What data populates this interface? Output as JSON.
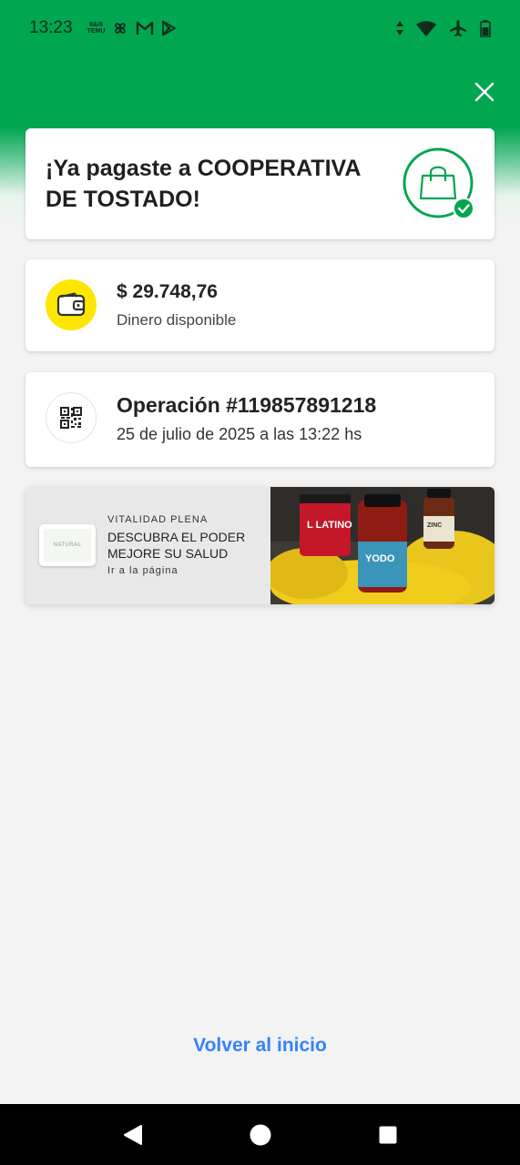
{
  "status_bar": {
    "time": "13:23",
    "left_icons": [
      "temu-icon",
      "pinwheel-icon",
      "gmail-icon",
      "play-store-icon"
    ],
    "right_icons": [
      "data-arrows-icon",
      "wifi-icon",
      "airplane-icon",
      "battery-icon"
    ],
    "temu_small_text": "TEMU"
  },
  "header": {
    "close_icon": "close-icon"
  },
  "confirmation": {
    "title": "¡Ya pagaste a COOPERATIVA DE TOSTADO!",
    "icon": "shopping-bag-check-icon"
  },
  "balance": {
    "amount": "$ 29.748,76",
    "label": "Dinero disponible",
    "icon": "wallet-icon"
  },
  "operation": {
    "title": "Operación #119857891218",
    "date": "25 de julio de 2025 a las 13:22 hs",
    "icon": "qr-code-icon"
  },
  "promo_banner": {
    "kicker": "VITALIDAD PLENA",
    "headline": "DESCUBRA EL PODER MEJORE SU SALUD",
    "link": "Ir a la página",
    "logo_text": "NATURAL",
    "product_labels": [
      "L LATINO",
      "YODO",
      "ZINC"
    ]
  },
  "footer": {
    "back_link": "Volver al inicio"
  },
  "colors": {
    "brand_green": "#00a650",
    "link_blue": "#3483fa",
    "wallet_yellow": "#ffe600",
    "background": "#f3f3f3"
  }
}
